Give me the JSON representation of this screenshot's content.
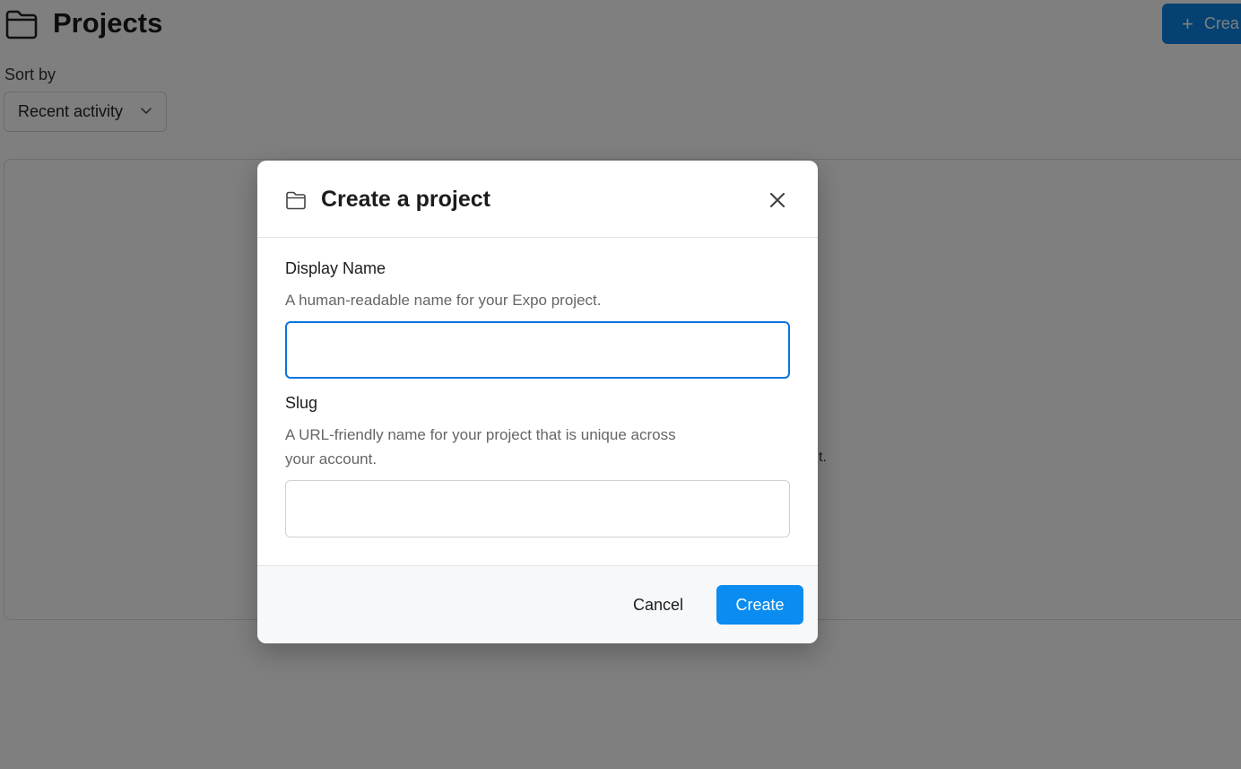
{
  "page": {
    "title": "Projects",
    "create_button_label": "Crea",
    "sort_by_label": "Sort by",
    "sort_value": "Recent activity",
    "panel_peek_text": "t."
  },
  "modal": {
    "title": "Create a project",
    "display_name": {
      "label": "Display Name",
      "help": "A human-readable name for your Expo project.",
      "value": "",
      "placeholder": ""
    },
    "slug": {
      "label": "Slug",
      "help_line1": "A URL-friendly name for your project that is unique across",
      "help_line2": "your account.",
      "value": "",
      "placeholder": ""
    },
    "cancel_label": "Cancel",
    "create_label": "Create"
  },
  "colors": {
    "accent": "#0a8cf0",
    "focus_border": "#0a74e0",
    "overlay": "rgba(0,0,0,0.5)"
  },
  "icons": {
    "header_icon": "folder-icon",
    "sort_chevron": "chevron-down-icon",
    "modal_icon": "folder-icon",
    "close": "close-icon",
    "create_plus": "plus-icon"
  }
}
